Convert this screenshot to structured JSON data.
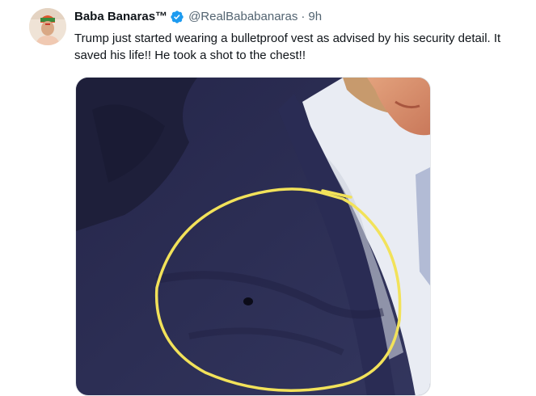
{
  "tweet": {
    "author": {
      "display_name": "Baba Banaras™",
      "handle": "@RealBababanaras",
      "verified_icon": "verified-badge-icon",
      "avatar_icon": "avatar"
    },
    "separator": "·",
    "timestamp": "9h",
    "text": "Trump just started wearing a bulletproof vest as advised by his security detail. It saved his life!! He took a shot to the chest!!",
    "media": {
      "alt": "Photo of a dark navy suit jacket with a small dark spot circled in yellow",
      "circle_color": "#f2e25a"
    }
  },
  "colors": {
    "text": "#0f1419",
    "secondary": "#536471",
    "verified": "#1d9bf0",
    "suit": "#2c2e52"
  }
}
